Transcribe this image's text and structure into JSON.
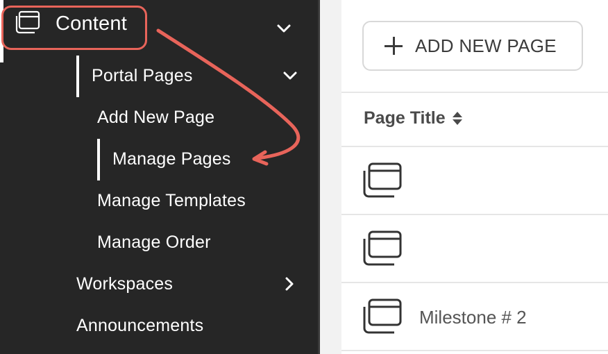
{
  "sidebar": {
    "content_label": "Content",
    "portal_pages_label": "Portal Pages",
    "add_new_page_label": "Add New Page",
    "manage_pages_label": "Manage Pages",
    "manage_templates_label": "Manage Templates",
    "manage_order_label": "Manage Order",
    "workspaces_label": "Workspaces",
    "announcements_label": "Announcements"
  },
  "toolbar": {
    "add_new_page_button": "ADD NEW PAGE"
  },
  "table": {
    "column_title": "Page Title",
    "rows": [
      {
        "title": ""
      },
      {
        "title": ""
      },
      {
        "title": "Milestone # 2"
      }
    ]
  },
  "colors": {
    "sidebar_bg": "#262626",
    "highlight": "#e8645a",
    "text_light": "#ffffff"
  },
  "icons": {
    "content": "page-stack-icon",
    "expand": "chevron-down-icon",
    "collapsed": "chevron-right-icon",
    "add": "plus-icon",
    "sort": "sort-icon",
    "row": "page-stack-icon"
  }
}
